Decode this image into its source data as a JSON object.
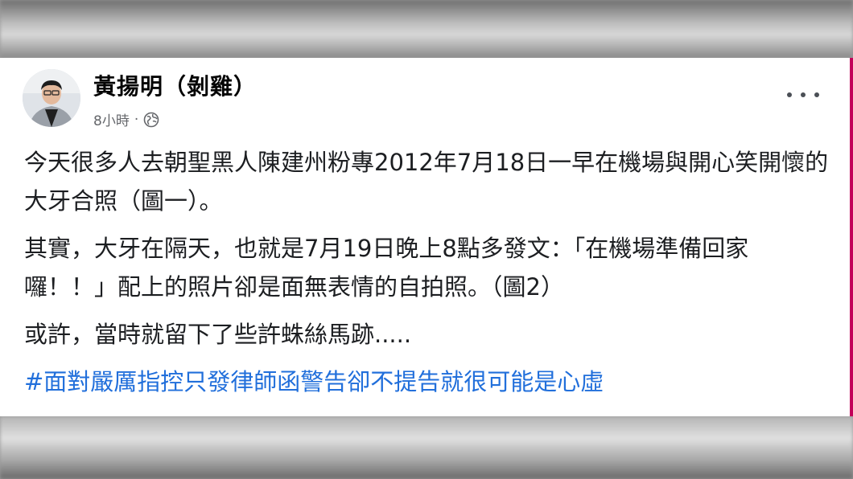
{
  "post": {
    "author_name": "黃揚明（剝雞）",
    "timestamp": "8小時",
    "separator": "·",
    "privacy_icon": "globe-icon",
    "more_icon": "more-options-icon",
    "paragraphs": [
      "今天很多人去朝聖黑人陳建州粉專2012年7月18日一早在機場與開心笑開懷的大牙合照（圖一）。",
      "其實，大牙在隔天，也就是7月19日晚上8點多發文：「在機場準備回家囉！！」配上的照片卻是面無表情的自拍照。（圖2）",
      "或許，當時就留下了些許蛛絲馬跡....."
    ],
    "hashtag": "#面對嚴厲指控只發律師函警告卻不提告就很可能是心虛"
  },
  "colors": {
    "text": "#1c1e21",
    "meta": "#65676b",
    "hashtag": "#216fdb",
    "edge_accent": "#c2005a"
  }
}
